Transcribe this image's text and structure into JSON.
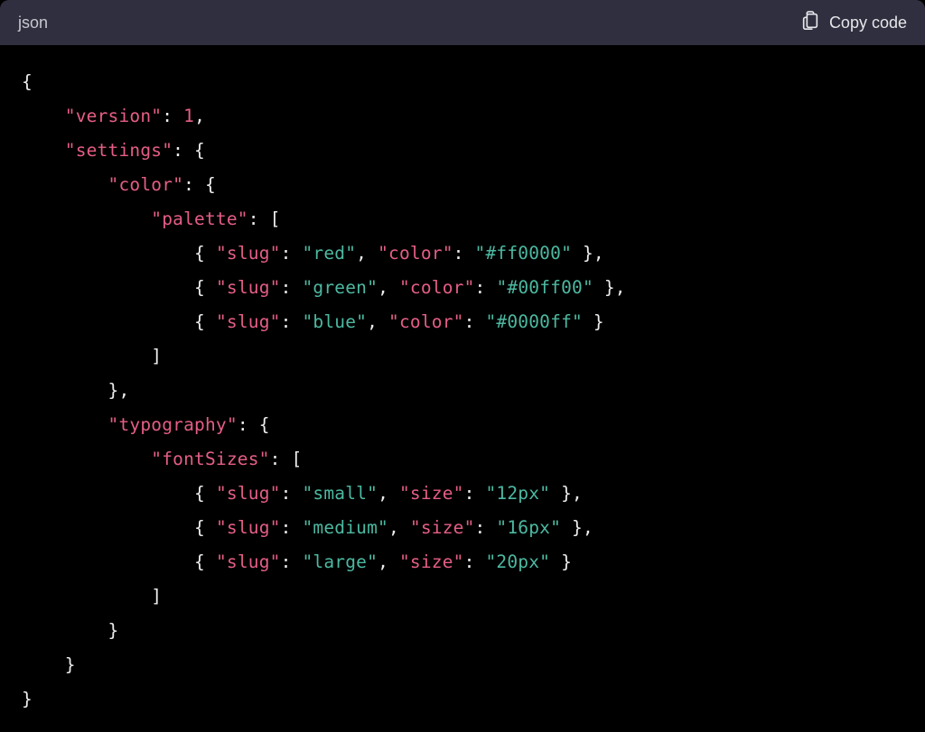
{
  "header": {
    "lang_label": "json",
    "copy_label": "Copy code"
  },
  "code": {
    "lines": [
      [
        {
          "t": "punct",
          "v": "{"
        }
      ],
      [
        {
          "t": "indent",
          "n": 1
        },
        {
          "t": "key",
          "v": "\"version\""
        },
        {
          "t": "punct",
          "v": ": "
        },
        {
          "t": "num",
          "v": "1"
        },
        {
          "t": "punct",
          "v": ","
        }
      ],
      [
        {
          "t": "indent",
          "n": 1
        },
        {
          "t": "key",
          "v": "\"settings\""
        },
        {
          "t": "punct",
          "v": ": {"
        }
      ],
      [
        {
          "t": "indent",
          "n": 2
        },
        {
          "t": "key",
          "v": "\"color\""
        },
        {
          "t": "punct",
          "v": ": {"
        }
      ],
      [
        {
          "t": "indent",
          "n": 3
        },
        {
          "t": "key",
          "v": "\"palette\""
        },
        {
          "t": "punct",
          "v": ": ["
        }
      ],
      [
        {
          "t": "indent",
          "n": 4
        },
        {
          "t": "punct",
          "v": "{ "
        },
        {
          "t": "key",
          "v": "\"slug\""
        },
        {
          "t": "punct",
          "v": ": "
        },
        {
          "t": "str",
          "v": "\"red\""
        },
        {
          "t": "punct",
          "v": ", "
        },
        {
          "t": "key",
          "v": "\"color\""
        },
        {
          "t": "punct",
          "v": ": "
        },
        {
          "t": "str",
          "v": "\"#ff0000\""
        },
        {
          "t": "punct",
          "v": " },"
        }
      ],
      [
        {
          "t": "indent",
          "n": 4
        },
        {
          "t": "punct",
          "v": "{ "
        },
        {
          "t": "key",
          "v": "\"slug\""
        },
        {
          "t": "punct",
          "v": ": "
        },
        {
          "t": "str",
          "v": "\"green\""
        },
        {
          "t": "punct",
          "v": ", "
        },
        {
          "t": "key",
          "v": "\"color\""
        },
        {
          "t": "punct",
          "v": ": "
        },
        {
          "t": "str",
          "v": "\"#00ff00\""
        },
        {
          "t": "punct",
          "v": " },"
        }
      ],
      [
        {
          "t": "indent",
          "n": 4
        },
        {
          "t": "punct",
          "v": "{ "
        },
        {
          "t": "key",
          "v": "\"slug\""
        },
        {
          "t": "punct",
          "v": ": "
        },
        {
          "t": "str",
          "v": "\"blue\""
        },
        {
          "t": "punct",
          "v": ", "
        },
        {
          "t": "key",
          "v": "\"color\""
        },
        {
          "t": "punct",
          "v": ": "
        },
        {
          "t": "str",
          "v": "\"#0000ff\""
        },
        {
          "t": "punct",
          "v": " }"
        }
      ],
      [
        {
          "t": "indent",
          "n": 3
        },
        {
          "t": "punct",
          "v": "]"
        }
      ],
      [
        {
          "t": "indent",
          "n": 2
        },
        {
          "t": "punct",
          "v": "},"
        }
      ],
      [
        {
          "t": "indent",
          "n": 2
        },
        {
          "t": "key",
          "v": "\"typography\""
        },
        {
          "t": "punct",
          "v": ": {"
        }
      ],
      [
        {
          "t": "indent",
          "n": 3
        },
        {
          "t": "key",
          "v": "\"fontSizes\""
        },
        {
          "t": "punct",
          "v": ": ["
        }
      ],
      [
        {
          "t": "indent",
          "n": 4
        },
        {
          "t": "punct",
          "v": "{ "
        },
        {
          "t": "key",
          "v": "\"slug\""
        },
        {
          "t": "punct",
          "v": ": "
        },
        {
          "t": "str",
          "v": "\"small\""
        },
        {
          "t": "punct",
          "v": ", "
        },
        {
          "t": "key",
          "v": "\"size\""
        },
        {
          "t": "punct",
          "v": ": "
        },
        {
          "t": "str",
          "v": "\"12px\""
        },
        {
          "t": "punct",
          "v": " },"
        }
      ],
      [
        {
          "t": "indent",
          "n": 4
        },
        {
          "t": "punct",
          "v": "{ "
        },
        {
          "t": "key",
          "v": "\"slug\""
        },
        {
          "t": "punct",
          "v": ": "
        },
        {
          "t": "str",
          "v": "\"medium\""
        },
        {
          "t": "punct",
          "v": ", "
        },
        {
          "t": "key",
          "v": "\"size\""
        },
        {
          "t": "punct",
          "v": ": "
        },
        {
          "t": "str",
          "v": "\"16px\""
        },
        {
          "t": "punct",
          "v": " },"
        }
      ],
      [
        {
          "t": "indent",
          "n": 4
        },
        {
          "t": "punct",
          "v": "{ "
        },
        {
          "t": "key",
          "v": "\"slug\""
        },
        {
          "t": "punct",
          "v": ": "
        },
        {
          "t": "str",
          "v": "\"large\""
        },
        {
          "t": "punct",
          "v": ", "
        },
        {
          "t": "key",
          "v": "\"size\""
        },
        {
          "t": "punct",
          "v": ": "
        },
        {
          "t": "str",
          "v": "\"20px\""
        },
        {
          "t": "punct",
          "v": " }"
        }
      ],
      [
        {
          "t": "indent",
          "n": 3
        },
        {
          "t": "punct",
          "v": "]"
        }
      ],
      [
        {
          "t": "indent",
          "n": 2
        },
        {
          "t": "punct",
          "v": "}"
        }
      ],
      [
        {
          "t": "indent",
          "n": 1
        },
        {
          "t": "punct",
          "v": "}"
        }
      ],
      [
        {
          "t": "punct",
          "v": "}"
        }
      ]
    ],
    "indent_unit": "    "
  }
}
